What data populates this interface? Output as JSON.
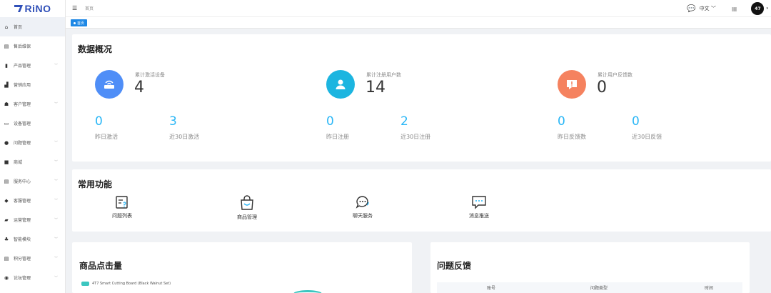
{
  "logo": {
    "text": "RiNO",
    "color": "#2f4fb8"
  },
  "sidebar": {
    "items": [
      {
        "label": "首页",
        "icon": "home-icon",
        "glyph": "⌂",
        "arrow": false
      },
      {
        "label": "售后维保",
        "icon": "document-icon",
        "glyph": "▤",
        "arrow": false
      },
      {
        "label": "产品管理",
        "icon": "book-icon",
        "glyph": "▮",
        "arrow": true
      },
      {
        "label": "营销应用",
        "icon": "bar-chart-icon",
        "glyph": "▟",
        "arrow": false
      },
      {
        "label": "客户管理",
        "icon": "users-icon",
        "glyph": "☗",
        "arrow": true
      },
      {
        "label": "设备管理",
        "icon": "device-icon",
        "glyph": "▭",
        "arrow": false
      },
      {
        "label": "问题管理",
        "icon": "question-icon",
        "glyph": "●",
        "arrow": true
      },
      {
        "label": "商城",
        "icon": "shop-icon",
        "glyph": "■",
        "arrow": true
      },
      {
        "label": "服务中心",
        "icon": "service-icon",
        "glyph": "▤",
        "arrow": true
      },
      {
        "label": "客服管理",
        "icon": "support-icon",
        "glyph": "◆",
        "arrow": true
      },
      {
        "label": "运营管理",
        "icon": "operations-icon",
        "glyph": "▰",
        "arrow": true
      },
      {
        "label": "智能模块",
        "icon": "smart-module-icon",
        "glyph": "♣",
        "arrow": true
      },
      {
        "label": "积分管理",
        "icon": "points-icon",
        "glyph": "▤",
        "arrow": true
      },
      {
        "label": "论坛管理",
        "icon": "forum-icon",
        "glyph": "◉",
        "arrow": true
      }
    ]
  },
  "topbar": {
    "breadcrumb": "首页",
    "language": "中文",
    "avatar_text": "47"
  },
  "tags": {
    "active": "首页"
  },
  "overview": {
    "title": "数据概况",
    "groups": [
      {
        "label": "累计激活设备",
        "value": "4",
        "color": "#4f8ef7",
        "icon": "wifi-router-icon",
        "sub": [
          {
            "value": "0",
            "label": "昨日激活"
          },
          {
            "value": "3",
            "label": "近30日激活"
          }
        ]
      },
      {
        "label": "累计注册用户数",
        "value": "14",
        "color": "#1cb5e0",
        "icon": "user-icon",
        "sub": [
          {
            "value": "0",
            "label": "昨日注册"
          },
          {
            "value": "2",
            "label": "近30日注册"
          }
        ]
      },
      {
        "label": "累计用户反馈数",
        "value": "0",
        "color": "#f5825f",
        "icon": "feedback-icon",
        "sub": [
          {
            "value": "0",
            "label": "昨日反馈数"
          },
          {
            "value": "0",
            "label": "近30日反馈"
          }
        ]
      }
    ]
  },
  "functions": {
    "title": "常用功能",
    "items": [
      {
        "label": "问题列表",
        "icon": "question-list-icon"
      },
      {
        "label": "商品管理",
        "icon": "shopping-bag-icon"
      },
      {
        "label": "聊天服务",
        "icon": "chat-service-icon"
      },
      {
        "label": "消息推送",
        "icon": "message-push-icon"
      }
    ]
  },
  "clicks": {
    "title": "商品点击量",
    "legend": "4T7 Smart Cutting Board (Black Walnut Set)",
    "legend_color": "#3cc6c0"
  },
  "feedback": {
    "title": "问题反馈",
    "columns": [
      "账号",
      "问题类型",
      "时间"
    ]
  }
}
